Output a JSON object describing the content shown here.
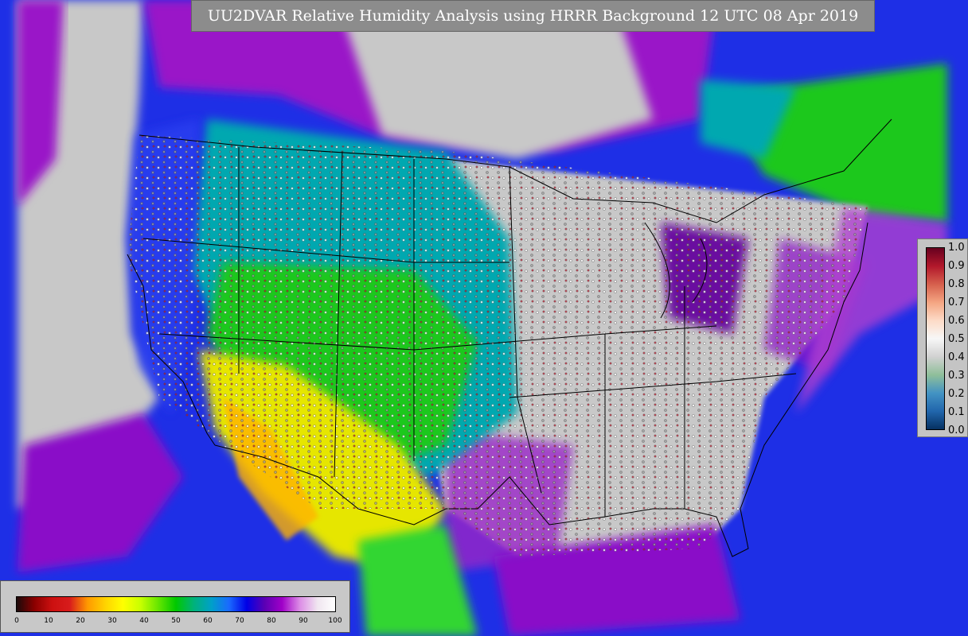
{
  "title": "UU2DVAR Relative Humidity Analysis using HRRR Background 12 UTC 08 Apr 2019",
  "field_colorbar": {
    "ticks": [
      "0",
      "10",
      "20",
      "30",
      "40",
      "50",
      "60",
      "70",
      "80",
      "90",
      "100"
    ],
    "colors": [
      "#1a0a0a",
      "#8b0000",
      "#cc1010",
      "#d81c1c",
      "#ff9900",
      "#ffd200",
      "#ffff00",
      "#c8ff00",
      "#66e600",
      "#00c800",
      "#00b27a",
      "#00a0c8",
      "#1a6aff",
      "#0000e6",
      "#5a00b4",
      "#a000c8",
      "#dc8ce6",
      "#f0e6f0",
      "#ffffff"
    ]
  },
  "station_colorbar": {
    "ticks": [
      "1.0",
      "0.9",
      "0.8",
      "0.7",
      "0.6",
      "0.5",
      "0.4",
      "0.3",
      "0.2",
      "0.1",
      "0.0"
    ],
    "colors": [
      "#67001f",
      "#b2182b",
      "#d6604d",
      "#f4a582",
      "#fddbc7",
      "#f7f7f7",
      "#d1d1d1",
      "#8fbf9a",
      "#4393c3",
      "#2166ac",
      "#053061"
    ]
  },
  "map_colors": {
    "ocean_blue": "#1e2fe6",
    "purple": "#8a10c8",
    "light_gray": "#c8c8c8",
    "green": "#1ec81e",
    "teal": "#00a8b0",
    "yellow": "#e6e600",
    "borders": "#000000"
  }
}
